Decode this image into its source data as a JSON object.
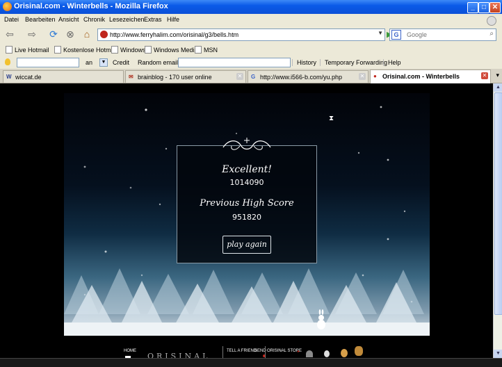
{
  "window": {
    "title": "Orisinal.com - Winterbells - Mozilla Firefox"
  },
  "menu": [
    "Datei",
    "Bearbeiten",
    "Ansicht",
    "Chronik",
    "Lesezeichen",
    "Extras",
    "Hilfe"
  ],
  "nav": {
    "url": "http://www.ferryhalim.com/orisinal/g3/bells.htm",
    "search_placeholder": "Google",
    "search_engine_icon": "google-icon"
  },
  "bookmarks": [
    "Live Hotmail",
    "Kostenlose Hotmail",
    "Windows",
    "Windows Media",
    "MSN"
  ],
  "toolbar": {
    "on_label": "an",
    "credit_label": "Credit",
    "random_label": "Random email",
    "history": "History",
    "temp_forward": "Temporary Forwarding",
    "help": "Help"
  },
  "tabs": [
    {
      "icon": "W",
      "label": "wiccat.de",
      "active": false
    },
    {
      "icon": "✉",
      "label": "brainblog - 170 user online",
      "active": false
    },
    {
      "icon": "G",
      "label": "http://www.i566-b.com/yu.php",
      "active": false
    },
    {
      "icon": "●",
      "label": "Orisinal.com - Winterbells",
      "active": true
    }
  ],
  "game": {
    "title": "Excellent!",
    "score": "1014090",
    "high_score_label": "Previous High Score",
    "high_score": "951820",
    "play_again": "play again"
  },
  "footer": {
    "home": "HOME",
    "brand": "ORISINAL",
    "tell": "TELL A FRIEND",
    "send": "SEND",
    "store": "ORISINAL STORE"
  },
  "colors": {
    "titlebar": "#0a5ae8",
    "chrome": "#ece9d8",
    "game_sky": "#05101e",
    "close": "#c3411f"
  }
}
